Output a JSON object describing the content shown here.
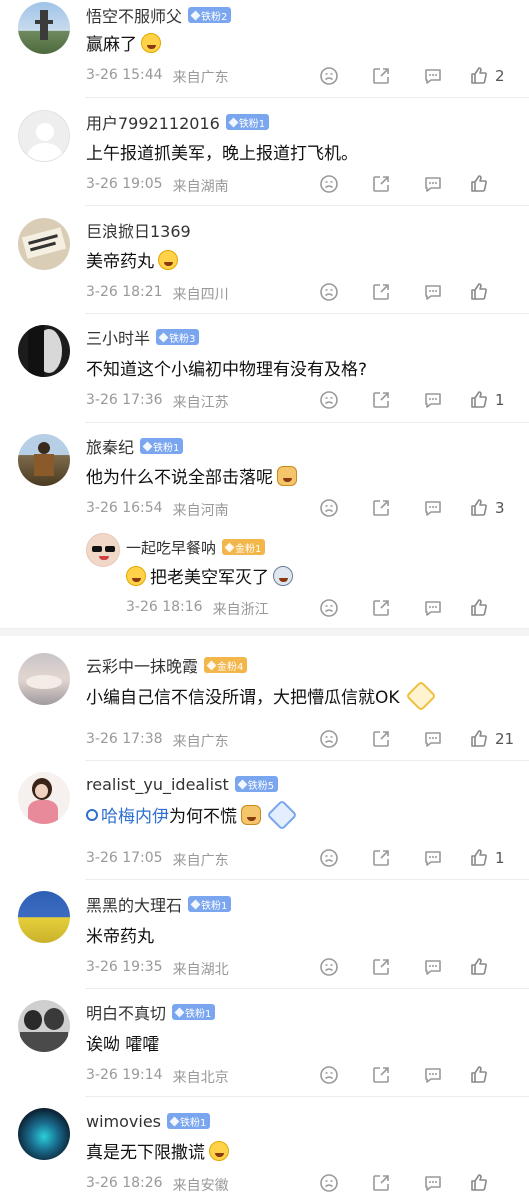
{
  "comments": [
    {
      "name": "悟空不服师父",
      "badge": "铁粉2",
      "text": "赢麻了",
      "time": "3-26 15:44",
      "loc": "来自广东",
      "likes": "2"
    },
    {
      "name": "用户7992112016",
      "badge": "铁粉1",
      "text": "上午报道抓美军，晚上报道打飞机。",
      "time": "3-26 19:05",
      "loc": "来自湖南",
      "likes": ""
    },
    {
      "name": "巨浪掀日1369",
      "badge": "",
      "text": "美帝药丸",
      "time": "3-26 18:21",
      "loc": "来自四川",
      "likes": ""
    },
    {
      "name": "三小时半",
      "badge": "铁粉3",
      "text": "不知道这个小编初中物理有没有及格?",
      "time": "3-26 17:36",
      "loc": "来自江苏",
      "likes": "1"
    },
    {
      "name": "旅秦纪",
      "badge": "铁粉1",
      "text": "他为什么不说全部击落呢",
      "time": "3-26 16:54",
      "loc": "来自河南",
      "likes": "3"
    },
    {
      "name": "一起吃早餐呐",
      "badge": "金粉1",
      "text": "把老美空军灭了",
      "time": "3-26 18:16",
      "loc": "来自浙江",
      "likes": ""
    },
    {
      "name": "云彩中一抹晚霞",
      "badge": "金粉4",
      "text": "小编自己信不信没所谓，大把懵瓜信就OK",
      "time": "3-26 17:38",
      "loc": "来自广东",
      "likes": "21"
    },
    {
      "name": "realist_yu_idealist",
      "badge": "铁粉5",
      "topic": "哈梅内伊",
      "text": "为何不慌",
      "time": "3-26 17:05",
      "loc": "来自广东",
      "likes": "1"
    },
    {
      "name": "黑黑的大理石",
      "badge": "铁粉1",
      "text": "米帝药丸",
      "time": "3-26 19:35",
      "loc": "来自湖北",
      "likes": ""
    },
    {
      "name": "明白不真切",
      "badge": "铁粉1",
      "text": "诶呦 嚯嚯",
      "time": "3-26 19:14",
      "loc": "来自北京",
      "likes": ""
    },
    {
      "name": "wimovies",
      "badge": "铁粉1",
      "text": "真是无下限撒谎",
      "time": "3-26 18:26",
      "loc": "来自安徽",
      "likes": ""
    }
  ],
  "icons": {
    "dislike": "dislike-face-icon",
    "share": "share-icon",
    "reply": "comment-bubble-icon",
    "like": "thumbs-up-icon"
  },
  "colors": {
    "iron_badge": "#7aa6ef",
    "gold_badge": "#f2b64a",
    "topic": "#2f6fcf"
  }
}
